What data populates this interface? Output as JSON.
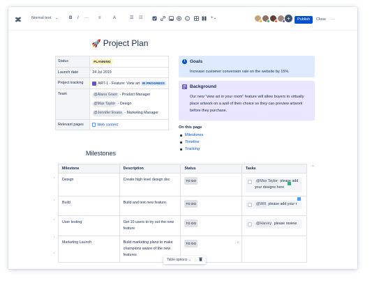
{
  "toolbar": {
    "text_style": "Normal text",
    "bold": "B",
    "italic": "I",
    "more_format": "···",
    "align": "≡",
    "color": "A",
    "bullets": "☰",
    "numbers": "☷",
    "more": "···",
    "publish_label": "Publish",
    "close_label": "Close",
    "overflow": "···"
  },
  "collaborators": {
    "colors": [
      "#ffab00",
      "#36b37e",
      "#ff5630",
      "#6554c0"
    ],
    "add": "+"
  },
  "page": {
    "title": "Project Plan",
    "title_emoji": "🚀"
  },
  "properties": {
    "status_key": "Status",
    "status_value": "PLANNING",
    "launch_key": "Launch date",
    "launch_value": "24 Jul 2019",
    "tracking_key": "Project tracking",
    "tracking_issue": "ART-1 - Feature: View art",
    "tracking_status": "IN PROGRESS",
    "team_key": "Team",
    "team": [
      {
        "mention": "@Alana Grant",
        "role": "- Product Manager"
      },
      {
        "mention": "@Max Taylor",
        "role": "- Design"
      },
      {
        "mention": "@Jennifer Evans",
        "role": "- Marketing Manager"
      }
    ],
    "pages_key": "Relevant pages",
    "pages_value": "Web content"
  },
  "goals": {
    "icon": "i",
    "title": "Goals",
    "body": "Increase customer conversion rate on the website by 15%."
  },
  "background": {
    "title": "Background",
    "body": "Our new \"view art in your room\" feature will allow buyers to virtually place artwork on a wall of their choice so they can preview artwork before they purchase."
  },
  "toc": {
    "title": "On this page",
    "items": [
      "Milestones",
      "Timeline",
      "Tracking"
    ]
  },
  "milestones": {
    "heading": "Milestones",
    "columns": [
      "Milestone",
      "Description",
      "Status",
      "Tasks"
    ],
    "rows": [
      {
        "milestone": "Design",
        "description": "Create high level design doc",
        "status": "TO DO",
        "task_mention": "@Max Taylor",
        "task_text": "please add your designs here"
      },
      {
        "milestone": "Build",
        "description": "Build and test new feature.",
        "status": "TO DO",
        "task_mention": "@Will",
        "task_text": "please add your r"
      },
      {
        "milestone": "User testing",
        "description": "Get 10 users to try out the new feature",
        "status": "TO DO",
        "task_mention": "@Harvey",
        "task_text": "please review"
      },
      {
        "milestone": "Marketing Launch",
        "description": "Build marketing plans to make champions aware of the new features",
        "status": "TO DO",
        "task_mention": "",
        "task_text": ""
      }
    ],
    "table_options": "Table options"
  }
}
